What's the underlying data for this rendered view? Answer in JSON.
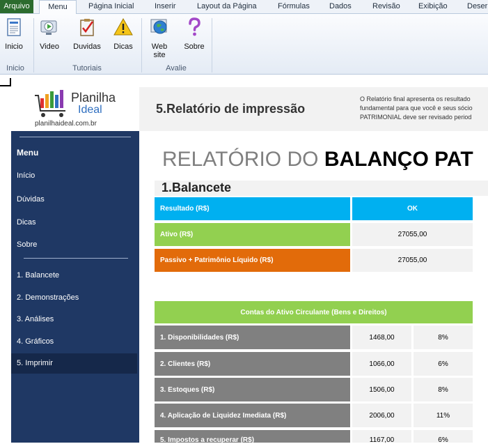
{
  "ribbon": {
    "tabs": {
      "file": "Arquivo",
      "menu": "Menu",
      "home": "Página Inicial",
      "insert": "Inserir",
      "layout": "Layout da Página",
      "formulas": "Fórmulas",
      "data": "Dados",
      "review": "Revisão",
      "view": "Exibição",
      "dev": "Deser"
    },
    "buttons": {
      "inicio": "Inicio",
      "video": "Video",
      "duvidas": "Duvidas",
      "dicas": "Dicas",
      "website_1": "Web",
      "website_2": "site",
      "sobre": "Sobre"
    },
    "groups": {
      "inicio": "Inicio",
      "tutoriais": "Tutoriais",
      "avalie": "Avalie"
    }
  },
  "logo": {
    "name_1": "Planilha",
    "name_2": "Ideal",
    "url": "planilhaideal.com.br"
  },
  "header": {
    "title": "5.Relatório de impressão",
    "desc_1": "O Relatório final apresenta os resultado",
    "desc_2": "fundamental para que você e seus sócio",
    "desc_3": "PATRIMONIAL  deve ser revisado period"
  },
  "sidebar": {
    "menu": "Menu",
    "inicio": "Início",
    "duvidas": "Dúvidas",
    "dicas": "Dicas",
    "sobre": "Sobre",
    "balancete": "1. Balancete",
    "demonstracoes": "2. Demonstrações",
    "analises": "3. Análises",
    "graficos": "4. Gráficos",
    "imprimir": "5. Imprimir"
  },
  "report": {
    "title_light": "RELATÓRIO DO ",
    "title_bold": "BALANÇO PAT",
    "section": "1.Balancete",
    "summary": {
      "resultado_label": "Resultado (R$)",
      "resultado_value": "OK",
      "ativo_label": "Ativo  (R$)",
      "ativo_value": "27055,00",
      "passivo_label": "Passivo + Patrimônio Líquido (R$)",
      "passivo_value": "27055,00"
    },
    "assets_header": "Contas do Ativo Circulante (Bens e Direitos)",
    "assets": [
      {
        "label": "1.  Disponibilidades (R$)",
        "value": "1468,00",
        "pct": "8%"
      },
      {
        "label": "2. Clientes  (R$)",
        "value": "1066,00",
        "pct": "6%"
      },
      {
        "label": "3. Estoques (R$)",
        "value": "1506,00",
        "pct": "8%"
      },
      {
        "label": "4. Aplicação de Liquidez Imediata (R$)",
        "value": "2006,00",
        "pct": "11%"
      },
      {
        "label": "5. Impostos  a recuperar (R$)",
        "value": "1167,00",
        "pct": "6%"
      }
    ]
  },
  "colors": {
    "sidebar": "#1f3864",
    "blue": "#00b0f0",
    "green": "#92d050",
    "orange": "#e26b0a",
    "gray": "#808080"
  },
  "icons": [
    "document-icon",
    "video-icon",
    "clipboard-check-icon",
    "warning-icon",
    "globe-icon",
    "question-icon"
  ]
}
